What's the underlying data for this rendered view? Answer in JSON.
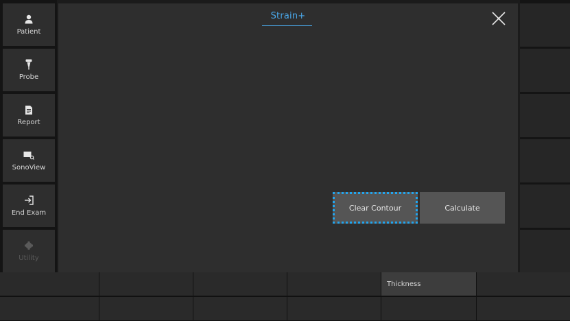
{
  "sidebar": {
    "items": [
      {
        "label": "Patient",
        "icon": "person-icon",
        "enabled": true
      },
      {
        "label": "Probe",
        "icon": "probe-icon",
        "enabled": true
      },
      {
        "label": "Report",
        "icon": "document-icon",
        "enabled": true
      },
      {
        "label": "SonoView",
        "icon": "sonoview-icon",
        "enabled": true
      },
      {
        "label": "End Exam",
        "icon": "exit-icon",
        "enabled": true
      },
      {
        "label": "Utility",
        "icon": "gear-icon",
        "enabled": false
      }
    ]
  },
  "panel": {
    "title": "Strain+",
    "close_icon": "close-icon",
    "buttons": {
      "clear_contour": "Clear Contour",
      "calculate": "Calculate"
    }
  },
  "bottom_bar": {
    "row1": [
      "",
      "",
      "",
      "",
      "Thickness",
      ""
    ],
    "row2": [
      "",
      "",
      "",
      "",
      "",
      ""
    ]
  },
  "colors": {
    "accent": "#4aa8ea",
    "focus_outline": "#21a6f0",
    "panel_bg": "#2e2e2e"
  }
}
